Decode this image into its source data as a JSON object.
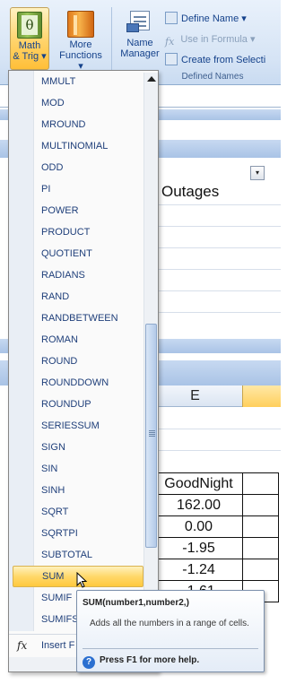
{
  "ribbon": {
    "math_trig": {
      "label_line1": "Math",
      "label_line2": "& Trig",
      "arrow": "▾",
      "icon": "theta-book-icon",
      "glyph": "θ"
    },
    "more_functions": {
      "label_line1": "More",
      "label_line2": "Functions",
      "arrow": "▾",
      "icon": "books-icon"
    },
    "name_manager": {
      "label_line1": "Name",
      "label_line2": "Manager",
      "icon": "name-manager-icon"
    },
    "define_name": {
      "label": "Define Name",
      "arrow": "▾"
    },
    "use_in_formula": {
      "label": "Use in Formula",
      "arrow": "▾",
      "icon_glyph": "fx"
    },
    "create_from_selection": {
      "label": "Create from Selecti"
    },
    "group_label": "Defined Names"
  },
  "sheet": {
    "column_e": "E",
    "header_text": "Outages",
    "table_header": "GoodNight",
    "table_values": [
      "162.00",
      "0.00",
      "-1.95",
      "-1.24",
      "-1.61"
    ],
    "filter_glyph": "▾"
  },
  "menu": {
    "items": [
      "MMULT",
      "MOD",
      "MROUND",
      "MULTINOMIAL",
      "ODD",
      "PI",
      "POWER",
      "PRODUCT",
      "QUOTIENT",
      "RADIANS",
      "RAND",
      "RANDBETWEEN",
      "ROMAN",
      "ROUND",
      "ROUNDDOWN",
      "ROUNDUP",
      "SERIESSUM",
      "SIGN",
      "SIN",
      "SINH",
      "SQRT",
      "SQRTPI",
      "SUBTOTAL",
      "SUM",
      "SUMIF",
      "SUMIFS"
    ],
    "highlighted": "SUM",
    "insert_function": {
      "icon": "fx",
      "label": "Insert F"
    }
  },
  "tooltip": {
    "title": "SUM(number1,number2,)",
    "description": "Adds all the numbers in a range of cells.",
    "help": "Press F1 for more help.",
    "help_icon": "?"
  },
  "colors": {
    "highlight": "#ffd86a",
    "menu_text": "#1f3f7a",
    "ribbon_text": "#15428b"
  }
}
